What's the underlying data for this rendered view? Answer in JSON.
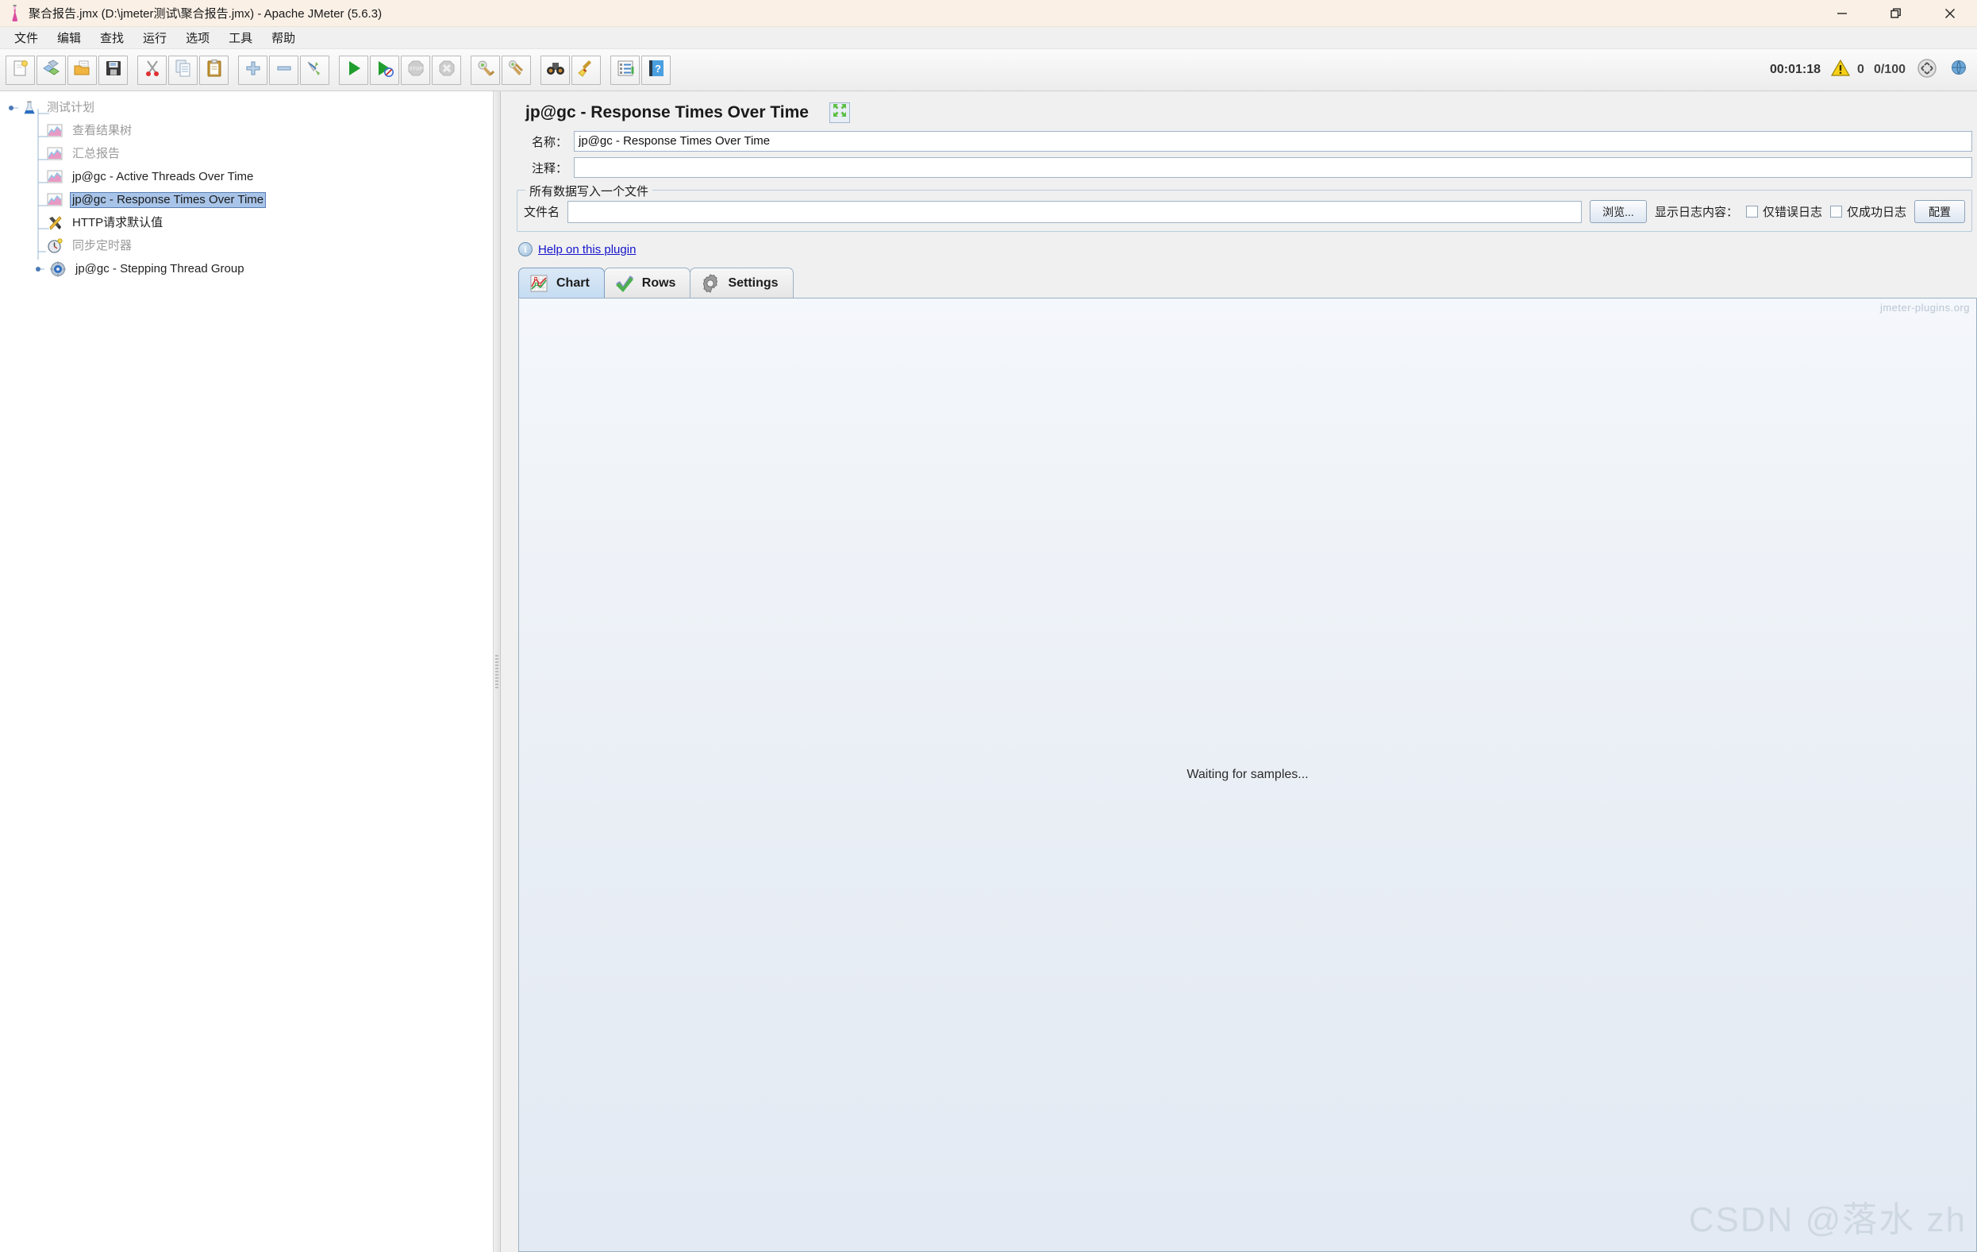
{
  "window": {
    "title": "聚合报告.jmx (D:\\jmeter测试\\聚合报告.jmx) - Apache JMeter (5.6.3)",
    "minimize_label": "—",
    "restore_label": "❐",
    "close_label": "✕"
  },
  "menubar": {
    "items": [
      {
        "label": "文件"
      },
      {
        "label": "编辑"
      },
      {
        "label": "查找"
      },
      {
        "label": "运行"
      },
      {
        "label": "选项"
      },
      {
        "label": "工具"
      },
      {
        "label": "帮助"
      }
    ]
  },
  "toolbar": {
    "buttons": [
      {
        "name": "new-icon",
        "title": "新建"
      },
      {
        "name": "templates-icon",
        "title": "模板"
      },
      {
        "name": "open-icon",
        "title": "打开"
      },
      {
        "name": "save-icon",
        "title": "保存"
      },
      {
        "name": "cut-icon",
        "title": "剪切"
      },
      {
        "name": "copy-icon",
        "title": "复制"
      },
      {
        "name": "paste-icon",
        "title": "粘贴"
      },
      {
        "name": "expand-all-icon",
        "title": "展开全部"
      },
      {
        "name": "collapse-all-icon",
        "title": "折叠全部"
      },
      {
        "name": "toggle-icon",
        "title": "切换"
      },
      {
        "name": "start-icon",
        "title": "启动"
      },
      {
        "name": "start-no-pause-icon",
        "title": "无暂停启动"
      },
      {
        "name": "stop-icon",
        "title": "停止"
      },
      {
        "name": "shutdown-icon",
        "title": "关闭"
      },
      {
        "name": "clear-icon",
        "title": "清除"
      },
      {
        "name": "clear-all-icon",
        "title": "清除全部"
      },
      {
        "name": "search-icon",
        "title": "搜索"
      },
      {
        "name": "reset-search-icon",
        "title": "重置搜索"
      },
      {
        "name": "function-helper-icon",
        "title": "函数助手"
      },
      {
        "name": "help-icon",
        "title": "帮助"
      }
    ],
    "timer": "00:01:18",
    "error_count": "0",
    "thread_count": "0/100",
    "warning_icon": "warning-triangle-icon",
    "remote_icon": "remote-engines-icon"
  },
  "tree": {
    "nodes": [
      {
        "label": "测试计划",
        "icon": "test-plan-icon",
        "state": "dim",
        "depth": 0,
        "expander": "expanded"
      },
      {
        "label": "查看结果树",
        "icon": "view-results-tree-icon",
        "state": "dim",
        "depth": 1,
        "expander": "none"
      },
      {
        "label": "汇总报告",
        "icon": "summary-report-icon",
        "state": "dim",
        "depth": 1,
        "expander": "none"
      },
      {
        "label": "jp@gc - Active Threads Over Time",
        "icon": "graph-listener-icon",
        "state": "normal",
        "depth": 1,
        "expander": "none"
      },
      {
        "label": "jp@gc - Response Times Over Time",
        "icon": "graph-listener-icon",
        "state": "selected",
        "depth": 1,
        "expander": "none"
      },
      {
        "label": "HTTP请求默认值",
        "icon": "http-defaults-icon",
        "state": "normal",
        "depth": 1,
        "expander": "none"
      },
      {
        "label": "同步定时器",
        "icon": "sync-timer-icon",
        "state": "dim",
        "depth": 1,
        "expander": "none"
      },
      {
        "label": "jp@gc - Stepping Thread Group",
        "icon": "thread-group-icon",
        "state": "normal",
        "depth": 1,
        "expander": "expanded"
      }
    ]
  },
  "panel": {
    "title": "jp@gc - Response Times Over Time",
    "expand_icon": "expand-arrows-icon",
    "name_label": "名称：",
    "name_value": "jp@gc - Response Times Over Time",
    "comment_label": "注释：",
    "comment_value": "",
    "file_group_title": "所有数据写入一个文件",
    "filename_label": "文件名",
    "filename_value": "",
    "filename_placeholder": "",
    "browse_label": "浏览...",
    "log_display_label": "显示日志内容：",
    "error_only_label": "仅错误日志",
    "error_only_checked": false,
    "success_only_label": "仅成功日志",
    "success_only_checked": false,
    "configure_label": "配置",
    "help_link_label": "Help on this plugin",
    "info_icon": "info-icon"
  },
  "tabs": [
    {
      "label": "Chart",
      "icon": "chart-icon",
      "active": true
    },
    {
      "label": "Rows",
      "icon": "checkmark-icon",
      "active": false
    },
    {
      "label": "Settings",
      "icon": "gear-icon",
      "active": false
    }
  ],
  "chart": {
    "watermark": "jmeter-plugins.org",
    "status_text": "Waiting for samples..."
  },
  "watermark": {
    "text": "CSDN @落水 zh"
  },
  "colors": {
    "titlebar_bg": "#faf0e6",
    "selection_blue": "#a8c4e8",
    "link_blue": "#1414cc",
    "active_tab": "#c5dcf2",
    "panel_bg": "#f0f0f0"
  }
}
